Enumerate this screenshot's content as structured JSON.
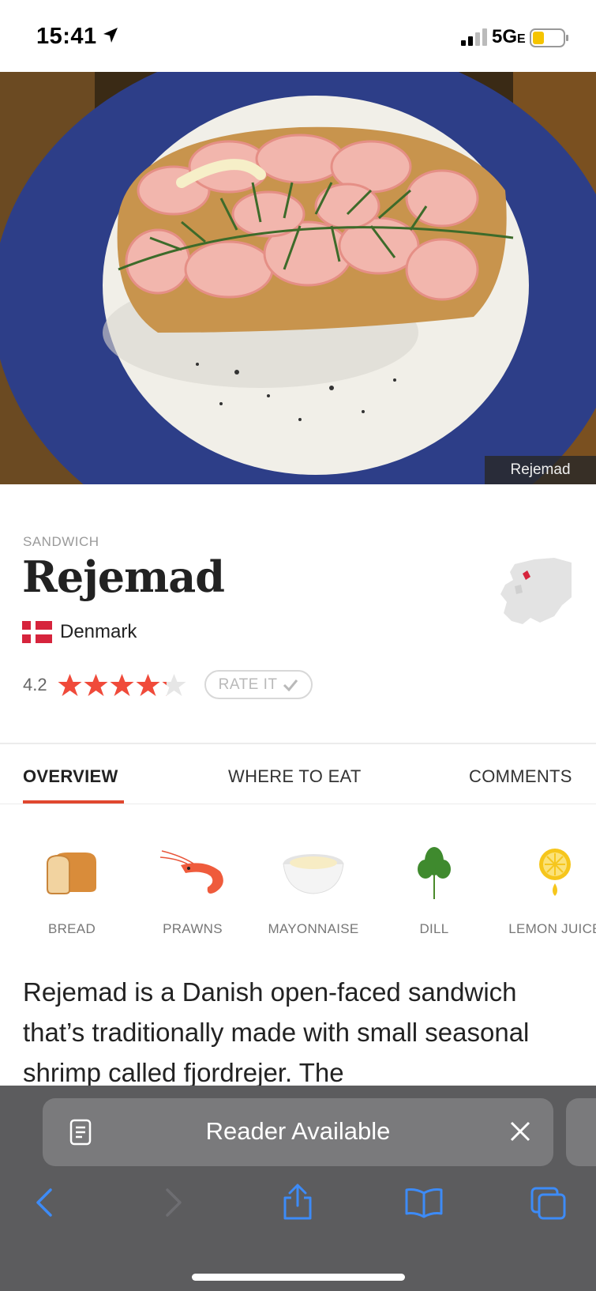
{
  "status_bar": {
    "time": "15:41",
    "network": "5G",
    "network_suffix": "E"
  },
  "hero": {
    "caption": "Rejemad"
  },
  "dish": {
    "category": "SANDWICH",
    "title": "Rejemad",
    "country": "Denmark",
    "rating": "4.2",
    "rating_value": 4.2,
    "rating_max": 5,
    "rate_label": "RATE IT"
  },
  "tabs": [
    {
      "label": "OVERVIEW",
      "active": true
    },
    {
      "label": "WHERE TO EAT",
      "active": false
    },
    {
      "label": "COMMENTS",
      "active": false
    }
  ],
  "ingredients": [
    {
      "label": "BREAD",
      "icon": "bread-icon"
    },
    {
      "label": "PRAWNS",
      "icon": "prawn-icon"
    },
    {
      "label": "MAYONNAISE",
      "icon": "mayonnaise-icon"
    },
    {
      "label": "DILL",
      "icon": "dill-icon"
    },
    {
      "label": "LEMON JUICE",
      "icon": "lemon-icon"
    }
  ],
  "description": "Rejemad is a Danish open-faced sandwich that’s traditionally made with small seasonal shrimp called fjordrejer. The",
  "safari": {
    "reader_text": "Reader Available"
  },
  "colors": {
    "accent": "#e0472f",
    "star": "#f04a3a",
    "toolbar": "#5c5c5e",
    "toolbar_icon": "#3d8bf7"
  }
}
